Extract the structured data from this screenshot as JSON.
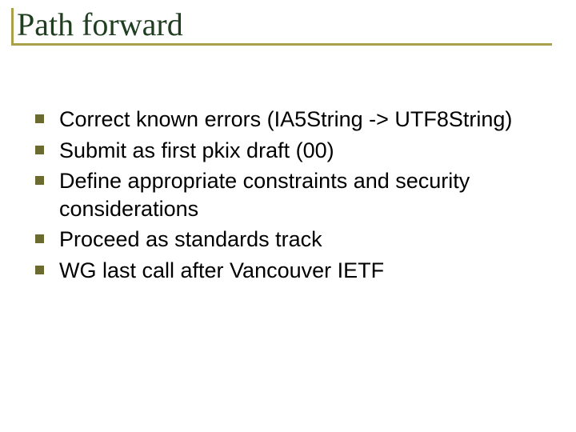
{
  "slide": {
    "title": "Path forward",
    "bullets": [
      "Correct known errors (IA5String -> UTF8String)",
      "Submit as first pkix draft (00)",
      "Define appropriate constraints and security considerations",
      "Proceed as standards track",
      "WG last call after Vancouver IETF"
    ]
  }
}
